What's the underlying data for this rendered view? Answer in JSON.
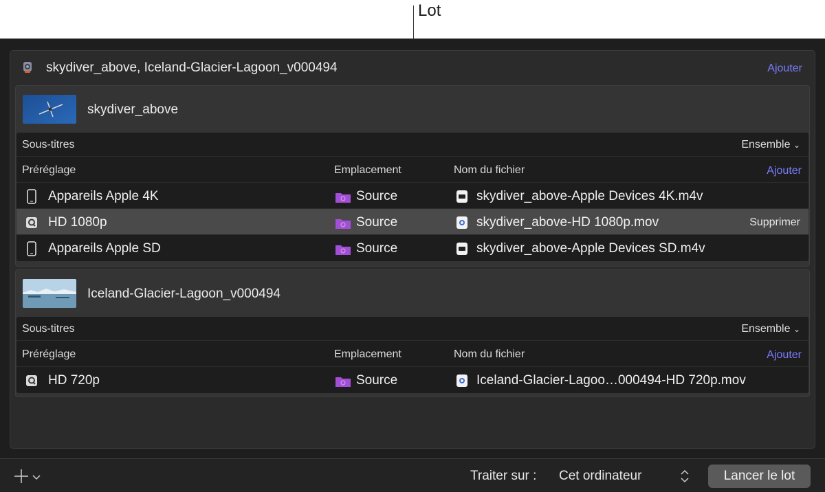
{
  "callout": {
    "label": "Lot"
  },
  "batch": {
    "title": "skydiver_above, Iceland-Glacier-Lagoon_v000494",
    "add_label": "Ajouter",
    "app_icon": "compressor-app-icon"
  },
  "jobs": [
    {
      "title": "skydiver_above",
      "subtitles_label": "Sous-titres",
      "subtitles_value": "Ensemble",
      "columns": {
        "preset": "Préréglage",
        "location": "Emplacement",
        "filename": "Nom du fichier"
      },
      "add_label": "Ajouter",
      "rows": [
        {
          "preset": "Appareils Apple 4K",
          "preset_icon": "iphone-icon",
          "location": "Source",
          "filename": "skydiver_above-Apple Devices 4K.m4v",
          "file_icon": "m4v-file-icon",
          "selected": false
        },
        {
          "preset": "HD 1080p",
          "preset_icon": "quicktime-icon",
          "location": "Source",
          "filename": "skydiver_above-HD 1080p.mov",
          "file_icon": "mov-file-icon",
          "selected": true,
          "remove_label": "Supprimer"
        },
        {
          "preset": "Appareils Apple SD",
          "preset_icon": "iphone-icon",
          "location": "Source",
          "filename": "skydiver_above-Apple Devices SD.m4v",
          "file_icon": "m4v-file-icon",
          "selected": false
        }
      ]
    },
    {
      "title": "Iceland-Glacier-Lagoon_v000494",
      "subtitles_label": "Sous-titres",
      "subtitles_value": "Ensemble",
      "columns": {
        "preset": "Préréglage",
        "location": "Emplacement",
        "filename": "Nom du fichier"
      },
      "add_label": "Ajouter",
      "rows": [
        {
          "preset": "HD 720p",
          "preset_icon": "quicktime-icon",
          "location": "Source",
          "filename": "Iceland-Glacier-Lagoo…000494-HD 720p.mov",
          "file_icon": "mov-file-icon",
          "selected": false
        }
      ]
    }
  ],
  "footer": {
    "process_label": "Traiter sur :",
    "process_value": "Cet ordinateur",
    "start_label": "Lancer le lot"
  },
  "colors": {
    "accent_link": "#7b7bff",
    "folder": "#a24fd6",
    "window_bg": "#1e1e1e",
    "selected_row": "#4a4a4a"
  }
}
